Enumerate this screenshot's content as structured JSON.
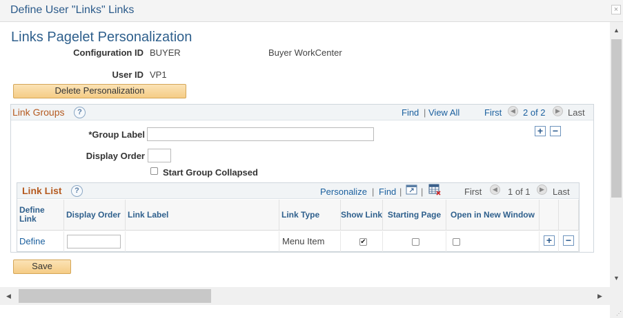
{
  "window": {
    "title": "Define User \"Links\" Links",
    "close_glyph": "×"
  },
  "page": {
    "heading": "Links Pagelet Personalization",
    "config_id_label": "Configuration ID",
    "config_id_value": "BUYER",
    "config_description": "Buyer WorkCenter",
    "user_id_label": "User ID",
    "user_id_value": "VP1",
    "delete_button": "Delete Personalization",
    "save_button": "Save"
  },
  "link_groups": {
    "title": "Link Groups",
    "help_glyph": "?",
    "find": "Find",
    "separator": "|",
    "view_all": "View All",
    "first": "First",
    "pagination": "2 of 2",
    "last": "Last",
    "group_label_label": "*Group Label",
    "group_label_value": "",
    "display_order_label": "Display Order",
    "display_order_value": "",
    "start_collapsed_label": "Start Group Collapsed",
    "start_collapsed_checked": false,
    "add_glyph": "+",
    "remove_glyph": "−"
  },
  "link_list": {
    "title": "Link List",
    "help_glyph": "?",
    "personalize": "Personalize",
    "find": "Find",
    "separator": "|",
    "first": "First",
    "pagination": "1 of 1",
    "last": "Last",
    "columns": {
      "define_link": "Define Link",
      "display_order": "Display Order",
      "link_label": "Link Label",
      "link_type": "Link Type",
      "show_link": "Show Link",
      "starting_page": "Starting Page",
      "open_new_window": "Open in New Window"
    },
    "rows": [
      {
        "define": "Define",
        "display_order": "",
        "link_label": "",
        "link_type": "Menu Item",
        "show_link": true,
        "starting_page": false,
        "open_new_window": false
      }
    ],
    "check_glyph": "✔",
    "add_glyph": "+",
    "remove_glyph": "−"
  },
  "icons": {
    "prev": "◀",
    "next": "▶",
    "up": "▲",
    "down": "▼",
    "left": "◀",
    "right": "▶"
  },
  "colors": {
    "link": "#1a5f9e",
    "group_title": "#b55a20",
    "heading": "#2e5f8c",
    "button_bg": "#f5cc85"
  }
}
